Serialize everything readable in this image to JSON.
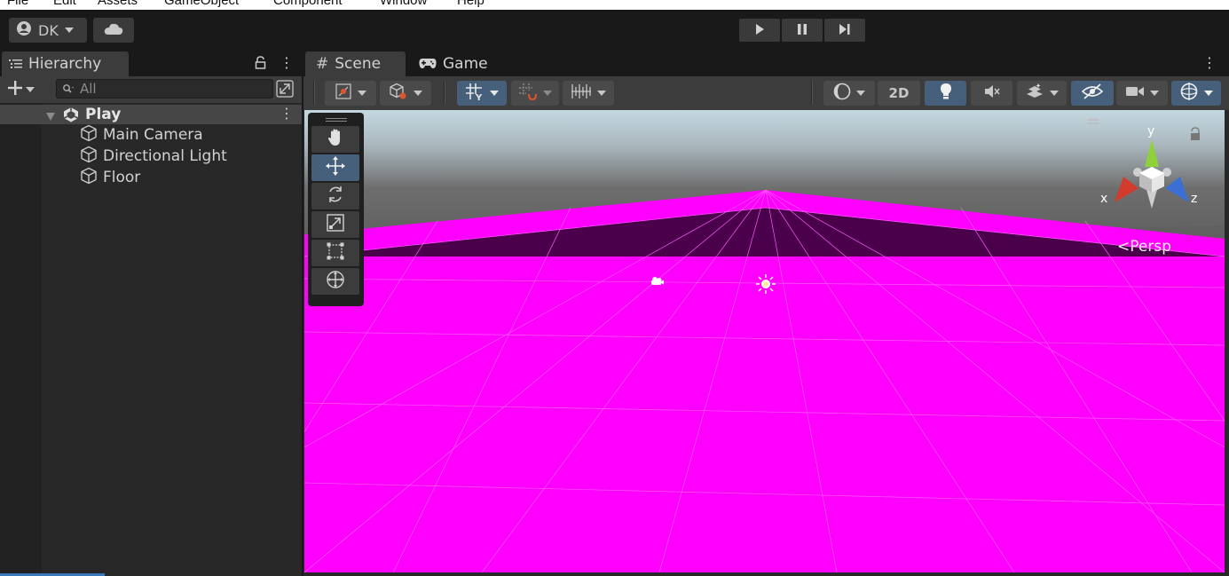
{
  "menubar": {
    "items": [
      "File",
      "Edit",
      "Assets",
      "GameObject",
      "Component",
      "Window",
      "Help"
    ]
  },
  "toolbar": {
    "account_label": "DK",
    "account_icon": "account-icon",
    "cloud_icon": "cloud-icon",
    "play_icon": "play-icon",
    "pause_icon": "pause-icon",
    "step_icon": "step-icon"
  },
  "hierarchy": {
    "tab_label": "Hierarchy",
    "search_placeholder": "All",
    "scene_name": "Play",
    "items": [
      {
        "label": "Main Camera",
        "icon": "gameobject-cube-icon"
      },
      {
        "label": "Directional Light",
        "icon": "gameobject-cube-icon"
      },
      {
        "label": "Floor",
        "icon": "gameobject-cube-icon"
      }
    ]
  },
  "scene_view": {
    "tabs": [
      {
        "label": "Scene",
        "icon": "grid-hash-icon",
        "active": true
      },
      {
        "label": "Game",
        "icon": "gamepad-icon",
        "active": false
      }
    ],
    "toolbar": {
      "btn_2d_label": "2D"
    },
    "tools": [
      "hand-tool",
      "move-tool",
      "rotate-tool",
      "scale-tool",
      "rect-tool",
      "transform-tool"
    ],
    "active_tool": "move-tool",
    "projection_label": "Persp",
    "axis_x": "x",
    "axis_y": "y",
    "axis_z": "z"
  },
  "colors": {
    "floor_magenta": "#ff00ff",
    "sky_top": "#c3d6df",
    "horizon_gray": "#707070",
    "active_blue": "#46607c",
    "axis_x": "#d33b2c",
    "axis_y": "#8ed13b",
    "axis_z": "#3b6fd3"
  }
}
